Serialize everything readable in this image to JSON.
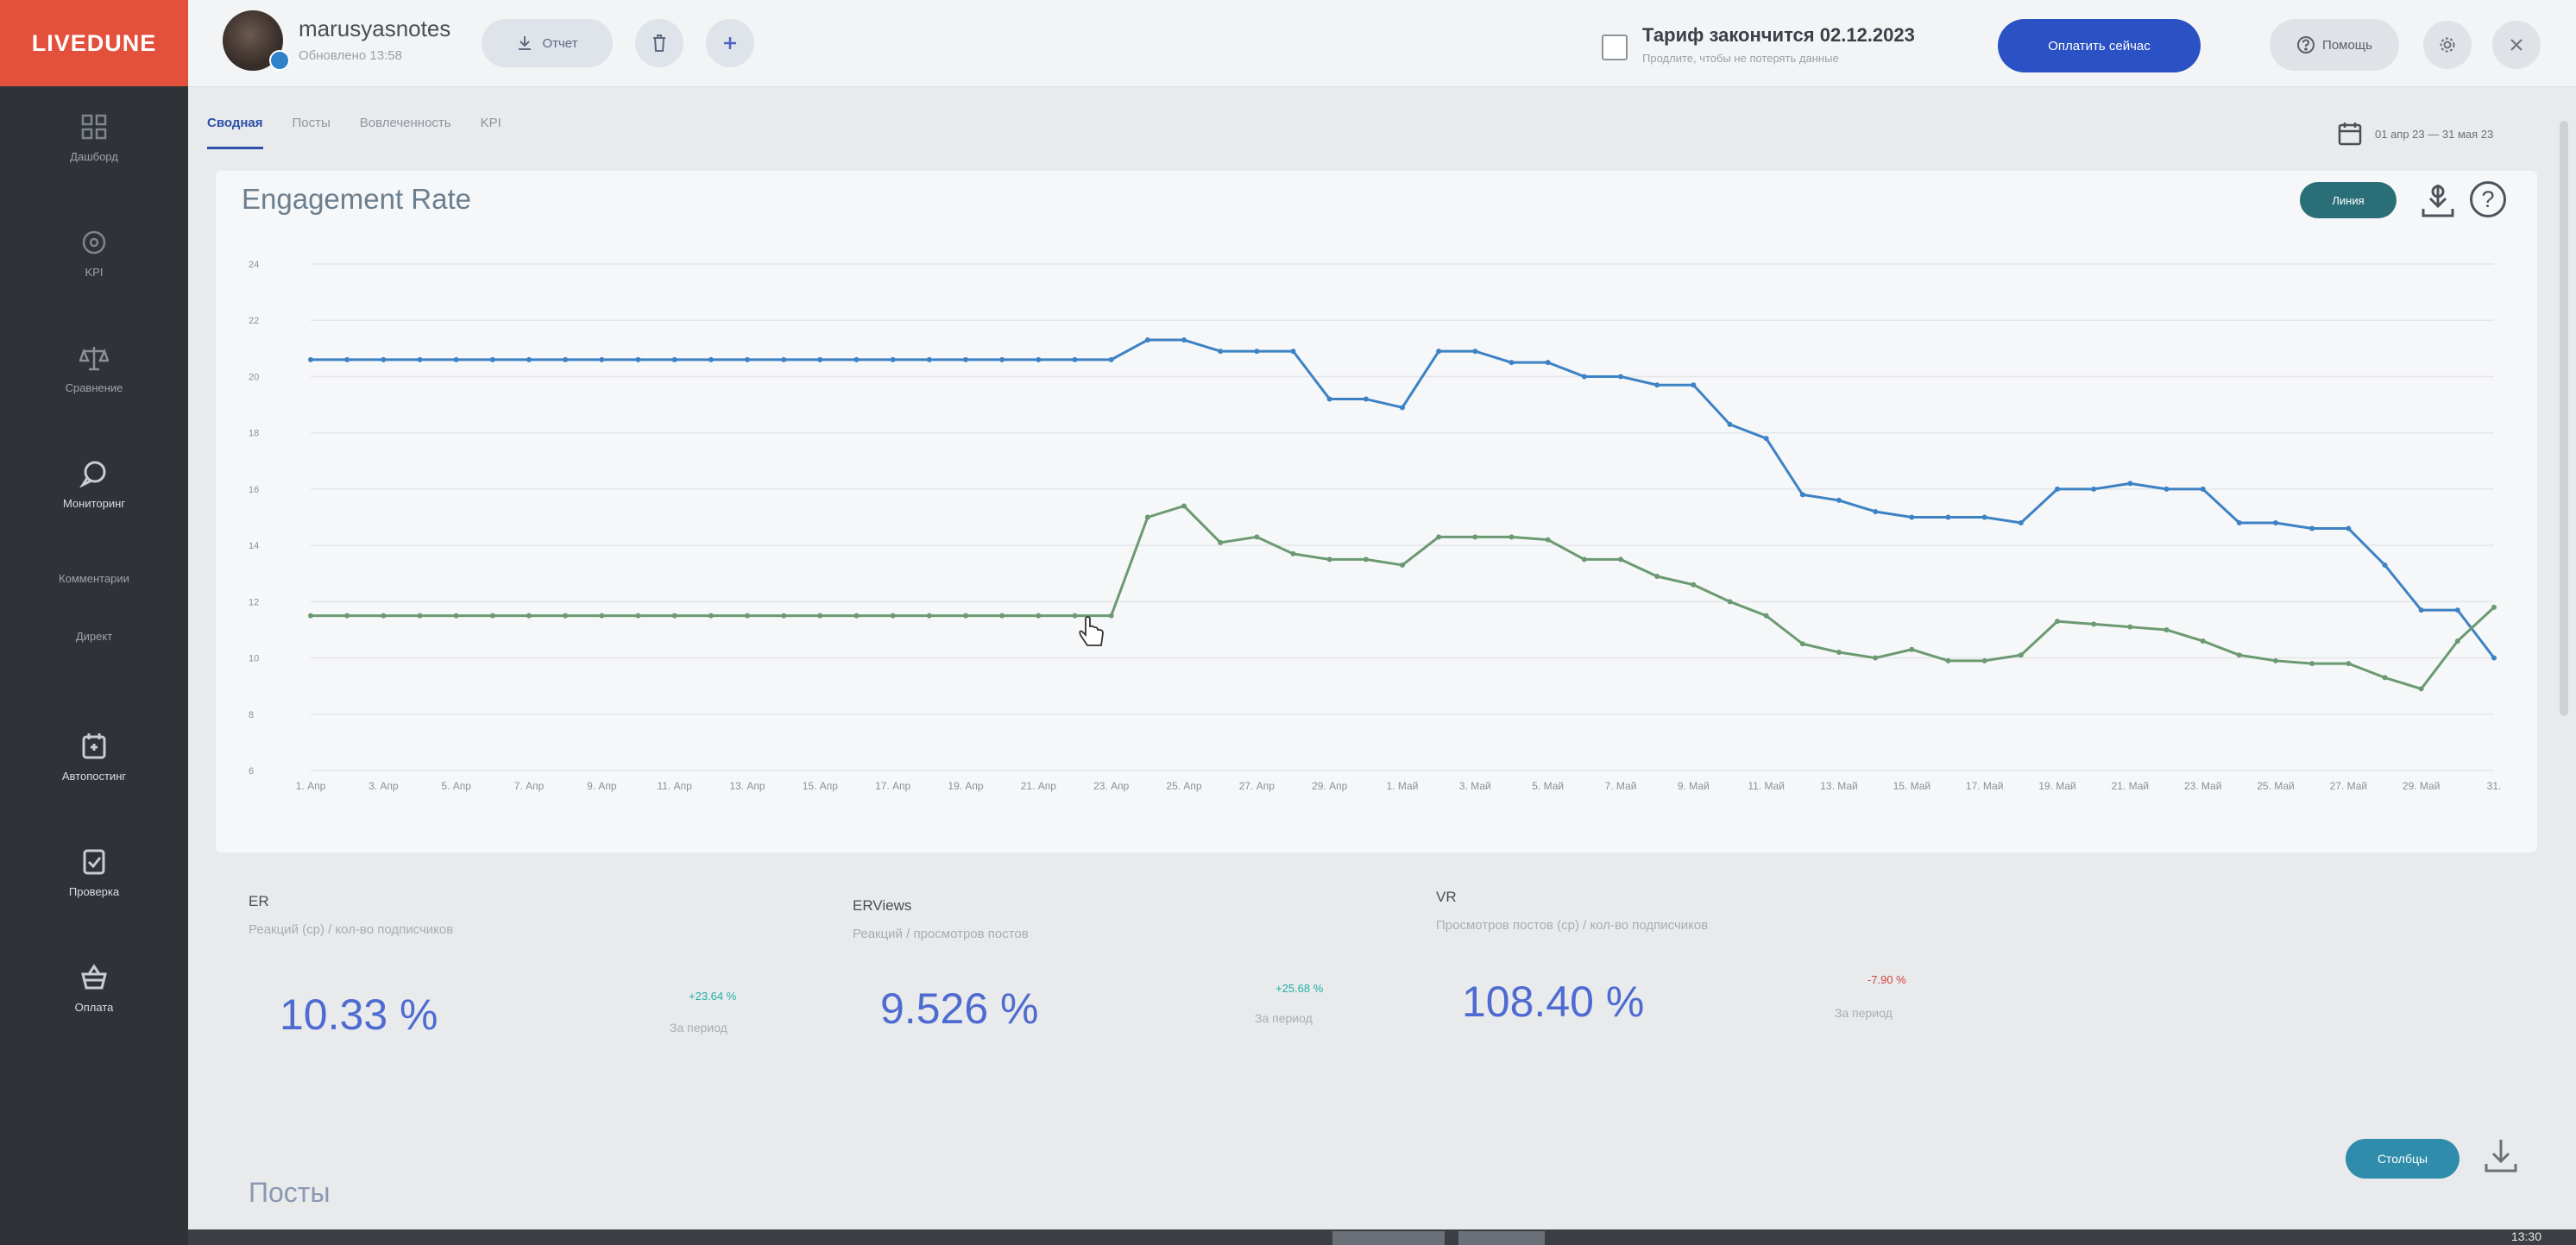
{
  "app": {
    "logo": "LIVEDUNE"
  },
  "sidebar": {
    "items": [
      {
        "label": "Дашборд",
        "icon": "grid-icon"
      },
      {
        "label": "KPI",
        "icon": "target-icon"
      },
      {
        "label": "Сравнение",
        "icon": "scales-icon"
      },
      {
        "label": "Мониторинг",
        "icon": "chat-bubble-icon"
      },
      {
        "label": "Комментарии",
        "icon": "comment-icon"
      },
      {
        "label": "Директ",
        "icon": "direct-icon"
      },
      {
        "label": "Автопостинг",
        "icon": "calendar-post-icon"
      },
      {
        "label": "Проверка",
        "icon": "check-shield-icon"
      },
      {
        "label": "Оплата",
        "icon": "basket-icon"
      }
    ]
  },
  "header": {
    "account_name": "marusyasnotes",
    "updated": "Обновлено 13:58",
    "report_label": "Отчет",
    "plan_title": "Тариф закончится 02.12.2023",
    "plan_sub": "Продлите, чтобы не потерять данные",
    "pay_label": "Оплатить сейчас",
    "help_label": "Помощь"
  },
  "tabs": [
    {
      "label": "Сводная",
      "active": true
    },
    {
      "label": "Посты",
      "active": false
    },
    {
      "label": "Вовлеченность",
      "active": false
    },
    {
      "label": "KPI",
      "active": false
    }
  ],
  "date_range": "01 апр 23 — 31 мая 23",
  "chart": {
    "title": "Engagement Rate",
    "type_button": "Линия",
    "colors": {
      "series1": "#3d82c4",
      "series2": "#6b9a72",
      "grid": "#e3e6ea"
    }
  },
  "chart_data": {
    "type": "line",
    "title": "Engagement Rate",
    "xlabel": "",
    "ylabel": "",
    "ylim": [
      6,
      24
    ],
    "yticks": [
      6,
      8,
      10,
      12,
      14,
      16,
      18,
      20,
      22,
      24
    ],
    "xtick_labels": [
      "1. Апр",
      "3. Апр",
      "5. Апр",
      "7. Апр",
      "9. Апр",
      "11. Апр",
      "13. Апр",
      "15. Апр",
      "17. Апр",
      "19. Апр",
      "21. Апр",
      "23. Апр",
      "25. Апр",
      "27. Апр",
      "29. Апр",
      "1. Май",
      "3. Май",
      "5. Май",
      "7. Май",
      "9. Май",
      "11. Май",
      "13. Май",
      "15. Май",
      "17. Май",
      "19. Май",
      "21. Май",
      "23. Май",
      "25. Май",
      "27. Май",
      "29. Май",
      "31."
    ],
    "series": [
      {
        "values": [
          20.6,
          20.6,
          20.6,
          20.6,
          20.6,
          20.6,
          20.6,
          20.6,
          20.6,
          20.6,
          20.6,
          20.6,
          20.6,
          20.6,
          20.6,
          20.6,
          20.6,
          20.6,
          20.6,
          20.6,
          20.6,
          20.6,
          20.6,
          21.3,
          21.3,
          20.9,
          20.9,
          20.9,
          19.2,
          19.2,
          18.9,
          20.9,
          20.9,
          20.5,
          20.5,
          20.0,
          20.0,
          19.7,
          19.7,
          18.3,
          17.8,
          15.8,
          15.6,
          15.2,
          15.0,
          15.0,
          15.0,
          14.8,
          16.0,
          16.0,
          16.2,
          16.0,
          16.0,
          14.8,
          14.8,
          14.6,
          14.6,
          13.3,
          11.7,
          11.7,
          10.0
        ]
      },
      {
        "values": [
          11.5,
          11.5,
          11.5,
          11.5,
          11.5,
          11.5,
          11.5,
          11.5,
          11.5,
          11.5,
          11.5,
          11.5,
          11.5,
          11.5,
          11.5,
          11.5,
          11.5,
          11.5,
          11.5,
          11.5,
          11.5,
          11.5,
          11.5,
          15.0,
          15.4,
          14.1,
          14.3,
          13.7,
          13.5,
          13.5,
          13.3,
          14.3,
          14.3,
          14.3,
          14.2,
          13.5,
          13.5,
          12.9,
          12.6,
          12.0,
          11.5,
          10.5,
          10.2,
          10.0,
          10.3,
          9.9,
          9.9,
          10.1,
          11.3,
          11.2,
          11.1,
          11.0,
          10.6,
          10.1,
          9.9,
          9.8,
          9.8,
          9.3,
          8.9,
          10.6,
          11.8
        ]
      }
    ]
  },
  "metrics": [
    {
      "title": "ER",
      "subtitle": "Реакций (ср) / кол-во подписчиков",
      "value": "10.33 %",
      "delta": "+23.64 %",
      "delta_color": "#21b0a4",
      "period": "За период"
    },
    {
      "title": "ERViews",
      "subtitle": "Реакций / просмотров постов",
      "value": "9.526 %",
      "delta": "+25.68 %",
      "delta_color": "#21b0a4",
      "period": "За период"
    },
    {
      "title": "VR",
      "subtitle": "Просмотров постов (ср) / кол-во подписчиков",
      "value": "108.40 %",
      "delta": "-7.90 %",
      "delta_color": "#d34242",
      "period": "За период"
    }
  ],
  "posts": {
    "title": "Посты",
    "columns_label": "Столбцы"
  },
  "taskbar": {
    "clock": "13:30"
  }
}
